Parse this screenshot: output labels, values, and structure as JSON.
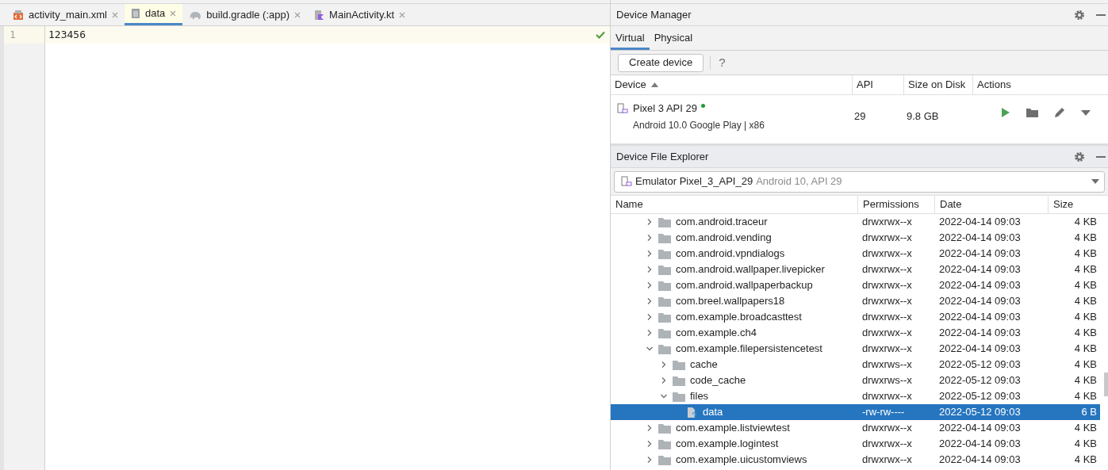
{
  "editor": {
    "tabs": [
      {
        "label": "activity_main.xml",
        "kind": "xml",
        "selected": false
      },
      {
        "label": "data",
        "kind": "text",
        "selected": true
      },
      {
        "label": "build.gradle (:app)",
        "kind": "gradle",
        "selected": false
      },
      {
        "label": "MainActivity.kt",
        "kind": "kotlin",
        "selected": false
      }
    ],
    "lines": [
      {
        "number": "1",
        "text": "123456"
      }
    ]
  },
  "device_manager": {
    "title": "Device Manager",
    "tabs": [
      {
        "label": "Virtual",
        "selected": true
      },
      {
        "label": "Physical",
        "selected": false
      }
    ],
    "create_button": "Create device",
    "help": "?",
    "columns": [
      "Device",
      "API",
      "Size on Disk",
      "Actions"
    ],
    "devices": [
      {
        "name": "Pixel 3 API 29",
        "online": true,
        "subtitle": "Android 10.0 Google Play | x86",
        "api": "29",
        "size": "9.8 GB"
      }
    ]
  },
  "file_explorer": {
    "title": "Device File Explorer",
    "device": {
      "name": "Emulator Pixel_3_API_29",
      "detail": "Android 10, API 29"
    },
    "columns": [
      "Name",
      "Permissions",
      "Date",
      "Size"
    ],
    "rows": [
      {
        "name": "com.android.traceur",
        "kind": "folder",
        "expanded": false,
        "selected": false,
        "permissions": "drwxrwx--x",
        "date": "2022-04-14 09:03",
        "size": "4 KB"
      },
      {
        "name": "com.android.vending",
        "kind": "folder",
        "expanded": false,
        "selected": false,
        "permissions": "drwxrwx--x",
        "date": "2022-04-14 09:03",
        "size": "4 KB"
      },
      {
        "name": "com.android.vpndialogs",
        "kind": "folder",
        "expanded": false,
        "selected": false,
        "permissions": "drwxrwx--x",
        "date": "2022-04-14 09:03",
        "size": "4 KB"
      },
      {
        "name": "com.android.wallpaper.livepicker",
        "kind": "folder",
        "expanded": false,
        "selected": false,
        "permissions": "drwxrwx--x",
        "date": "2022-04-14 09:03",
        "size": "4 KB"
      },
      {
        "name": "com.android.wallpaperbackup",
        "kind": "folder",
        "expanded": false,
        "selected": false,
        "permissions": "drwxrwx--x",
        "date": "2022-04-14 09:03",
        "size": "4 KB"
      },
      {
        "name": "com.breel.wallpapers18",
        "kind": "folder",
        "expanded": false,
        "selected": false,
        "permissions": "drwxrwx--x",
        "date": "2022-04-14 09:03",
        "size": "4 KB"
      },
      {
        "name": "com.example.broadcasttest",
        "kind": "folder",
        "expanded": false,
        "selected": false,
        "permissions": "drwxrwx--x",
        "date": "2022-04-14 09:03",
        "size": "4 KB"
      },
      {
        "name": "com.example.ch4",
        "kind": "folder",
        "expanded": false,
        "selected": false,
        "permissions": "drwxrwx--x",
        "date": "2022-04-14 09:03",
        "size": "4 KB"
      },
      {
        "name": "com.example.filepersistencetest",
        "kind": "folder",
        "expanded": true,
        "selected": false,
        "permissions": "drwxrwx--x",
        "date": "2022-04-14 09:03",
        "size": "4 KB",
        "children": [
          {
            "name": "cache",
            "kind": "folder",
            "expanded": false,
            "selected": false,
            "permissions": "drwxrws--x",
            "date": "2022-05-12 09:03",
            "size": "4 KB"
          },
          {
            "name": "code_cache",
            "kind": "folder",
            "expanded": false,
            "selected": false,
            "permissions": "drwxrws--x",
            "date": "2022-05-12 09:03",
            "size": "4 KB"
          },
          {
            "name": "files",
            "kind": "folder",
            "expanded": true,
            "selected": false,
            "permissions": "drwxrwx--x",
            "date": "2022-05-12 09:03",
            "size": "4 KB",
            "children": [
              {
                "name": "data",
                "kind": "file",
                "selected": true,
                "permissions": "-rw-rw----",
                "date": "2022-05-12 09:03",
                "size": "6 B"
              }
            ]
          }
        ]
      },
      {
        "name": "com.example.listviewtest",
        "kind": "folder",
        "expanded": false,
        "selected": false,
        "permissions": "drwxrwx--x",
        "date": "2022-04-14 09:03",
        "size": "4 KB"
      },
      {
        "name": "com.example.logintest",
        "kind": "folder",
        "expanded": false,
        "selected": false,
        "permissions": "drwxrwx--x",
        "date": "2022-04-14 09:03",
        "size": "4 KB"
      },
      {
        "name": "com.example.uicustomviews",
        "kind": "folder",
        "expanded": false,
        "selected": false,
        "permissions": "drwxrwx--x",
        "date": "2022-04-14 09:03",
        "size": "4 KB"
      }
    ]
  }
}
